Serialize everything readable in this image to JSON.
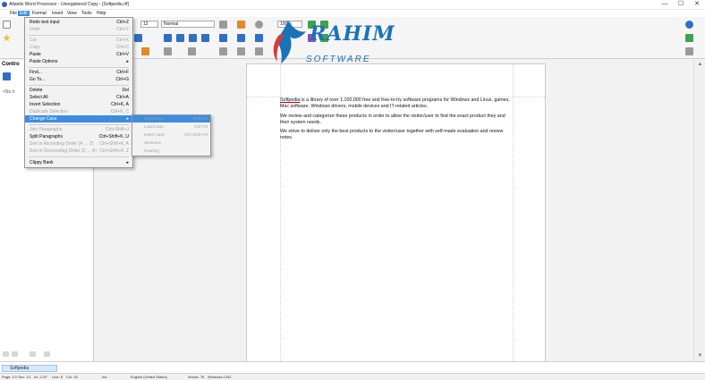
{
  "window": {
    "title": "Atlantis Word Processor - Unregistered Copy - [Softpedia.rtf]",
    "minimize": "—",
    "maximize": "☐",
    "close": "✕"
  },
  "menubar": [
    "File",
    "Edit",
    "Format",
    "Insert",
    "View",
    "Tools",
    "Help"
  ],
  "toolbar": {
    "font_size": "12",
    "style": "Normal",
    "zoom": "100%"
  },
  "left_panel": {
    "title": "Contro",
    "hint": "<No h"
  },
  "edit_menu": [
    {
      "label": "Redo text input",
      "shortcut": "Ctrl+Z",
      "state": "normal"
    },
    {
      "label": "Undo",
      "shortcut": "Ctrl+Y",
      "state": "disabled"
    },
    {
      "label": "Cut",
      "shortcut": "Ctrl+X",
      "state": "disabled"
    },
    {
      "label": "Copy",
      "shortcut": "Ctrl+C",
      "state": "disabled"
    },
    {
      "label": "Paste",
      "shortcut": "Ctrl+V",
      "state": "normal"
    },
    {
      "label": "Paste Options",
      "shortcut": "▸",
      "state": "normal"
    },
    {
      "label": "Find...",
      "shortcut": "Ctrl+F",
      "state": "normal"
    },
    {
      "label": "Go To...",
      "shortcut": "Ctrl+G",
      "state": "normal"
    },
    {
      "label": "Delete",
      "shortcut": "Del",
      "state": "normal"
    },
    {
      "label": "Select All",
      "shortcut": "Ctrl+A",
      "state": "normal"
    },
    {
      "label": "Invert Selection",
      "shortcut": "Ctrl+K, A",
      "state": "normal"
    },
    {
      "label": "Duplicate Selection",
      "shortcut": "Ctrl+K, C",
      "state": "disabled"
    },
    {
      "label": "Change Case",
      "shortcut": "▸",
      "state": "highlighted"
    },
    {
      "label": "Join Paragraphs",
      "shortcut": "Ctrl+Shift+J",
      "state": "disabled"
    },
    {
      "label": "Split Paragraphs",
      "shortcut": "Ctrl+Shift+K, U",
      "state": "normal"
    },
    {
      "label": "Sort in Ascending Order (A → Z)",
      "shortcut": "Ctrl+Shift+K, A",
      "state": "disabled"
    },
    {
      "label": "Sort in Descending Order (Z → A)",
      "shortcut": "Ctrl+Shift+K, Z",
      "state": "disabled"
    },
    {
      "label": "Clippy Bank",
      "shortcut": "▸",
      "state": "normal"
    }
  ],
  "change_case_submenu": [
    {
      "label": "Uppercase",
      "shortcut": "Shift+F3",
      "state": "highlighted"
    },
    {
      "label": "Lowercase",
      "shortcut": "Ctrl+F3",
      "state": "disabled"
    },
    {
      "label": "Invert Case",
      "shortcut": "Ctrl+Shift+F3",
      "state": "disabled"
    },
    {
      "label": "Sentence",
      "shortcut": "",
      "state": "disabled"
    },
    {
      "label": "Heading",
      "shortcut": "",
      "state": "disabled"
    }
  ],
  "document": {
    "p1_link": "Softpedia",
    "p1_rest": " is a library of over 1,100,000 free and free-to-try software programs for Windows and Linux, games, Mac software, Windows drivers, mobile devices and IT-related articles.",
    "p2": "We review and categorize these products in order to allow the visitor/user to find the exact product they and their system needs.",
    "p3": "We strive to deliver only the best products to the visitor/user together with self-made evaluation and review notes."
  },
  "watermark": {
    "name": "RAHIM",
    "sub": "SOFTWARE"
  },
  "bottom_tab": "Softpedia",
  "statusbar": {
    "page": "Page: 1/1",
    "sec": "Sec: 1/1",
    "at": "At: 1.00\"",
    "line": "Line: 8",
    "col": "Col: 18",
    "ins": "Ins",
    "lang": "English (United States)",
    "words": "Words: 78",
    "encoding": "Windows-1252"
  },
  "colors": {
    "accent": "#3c8de0",
    "logo": "#1c72b6"
  }
}
